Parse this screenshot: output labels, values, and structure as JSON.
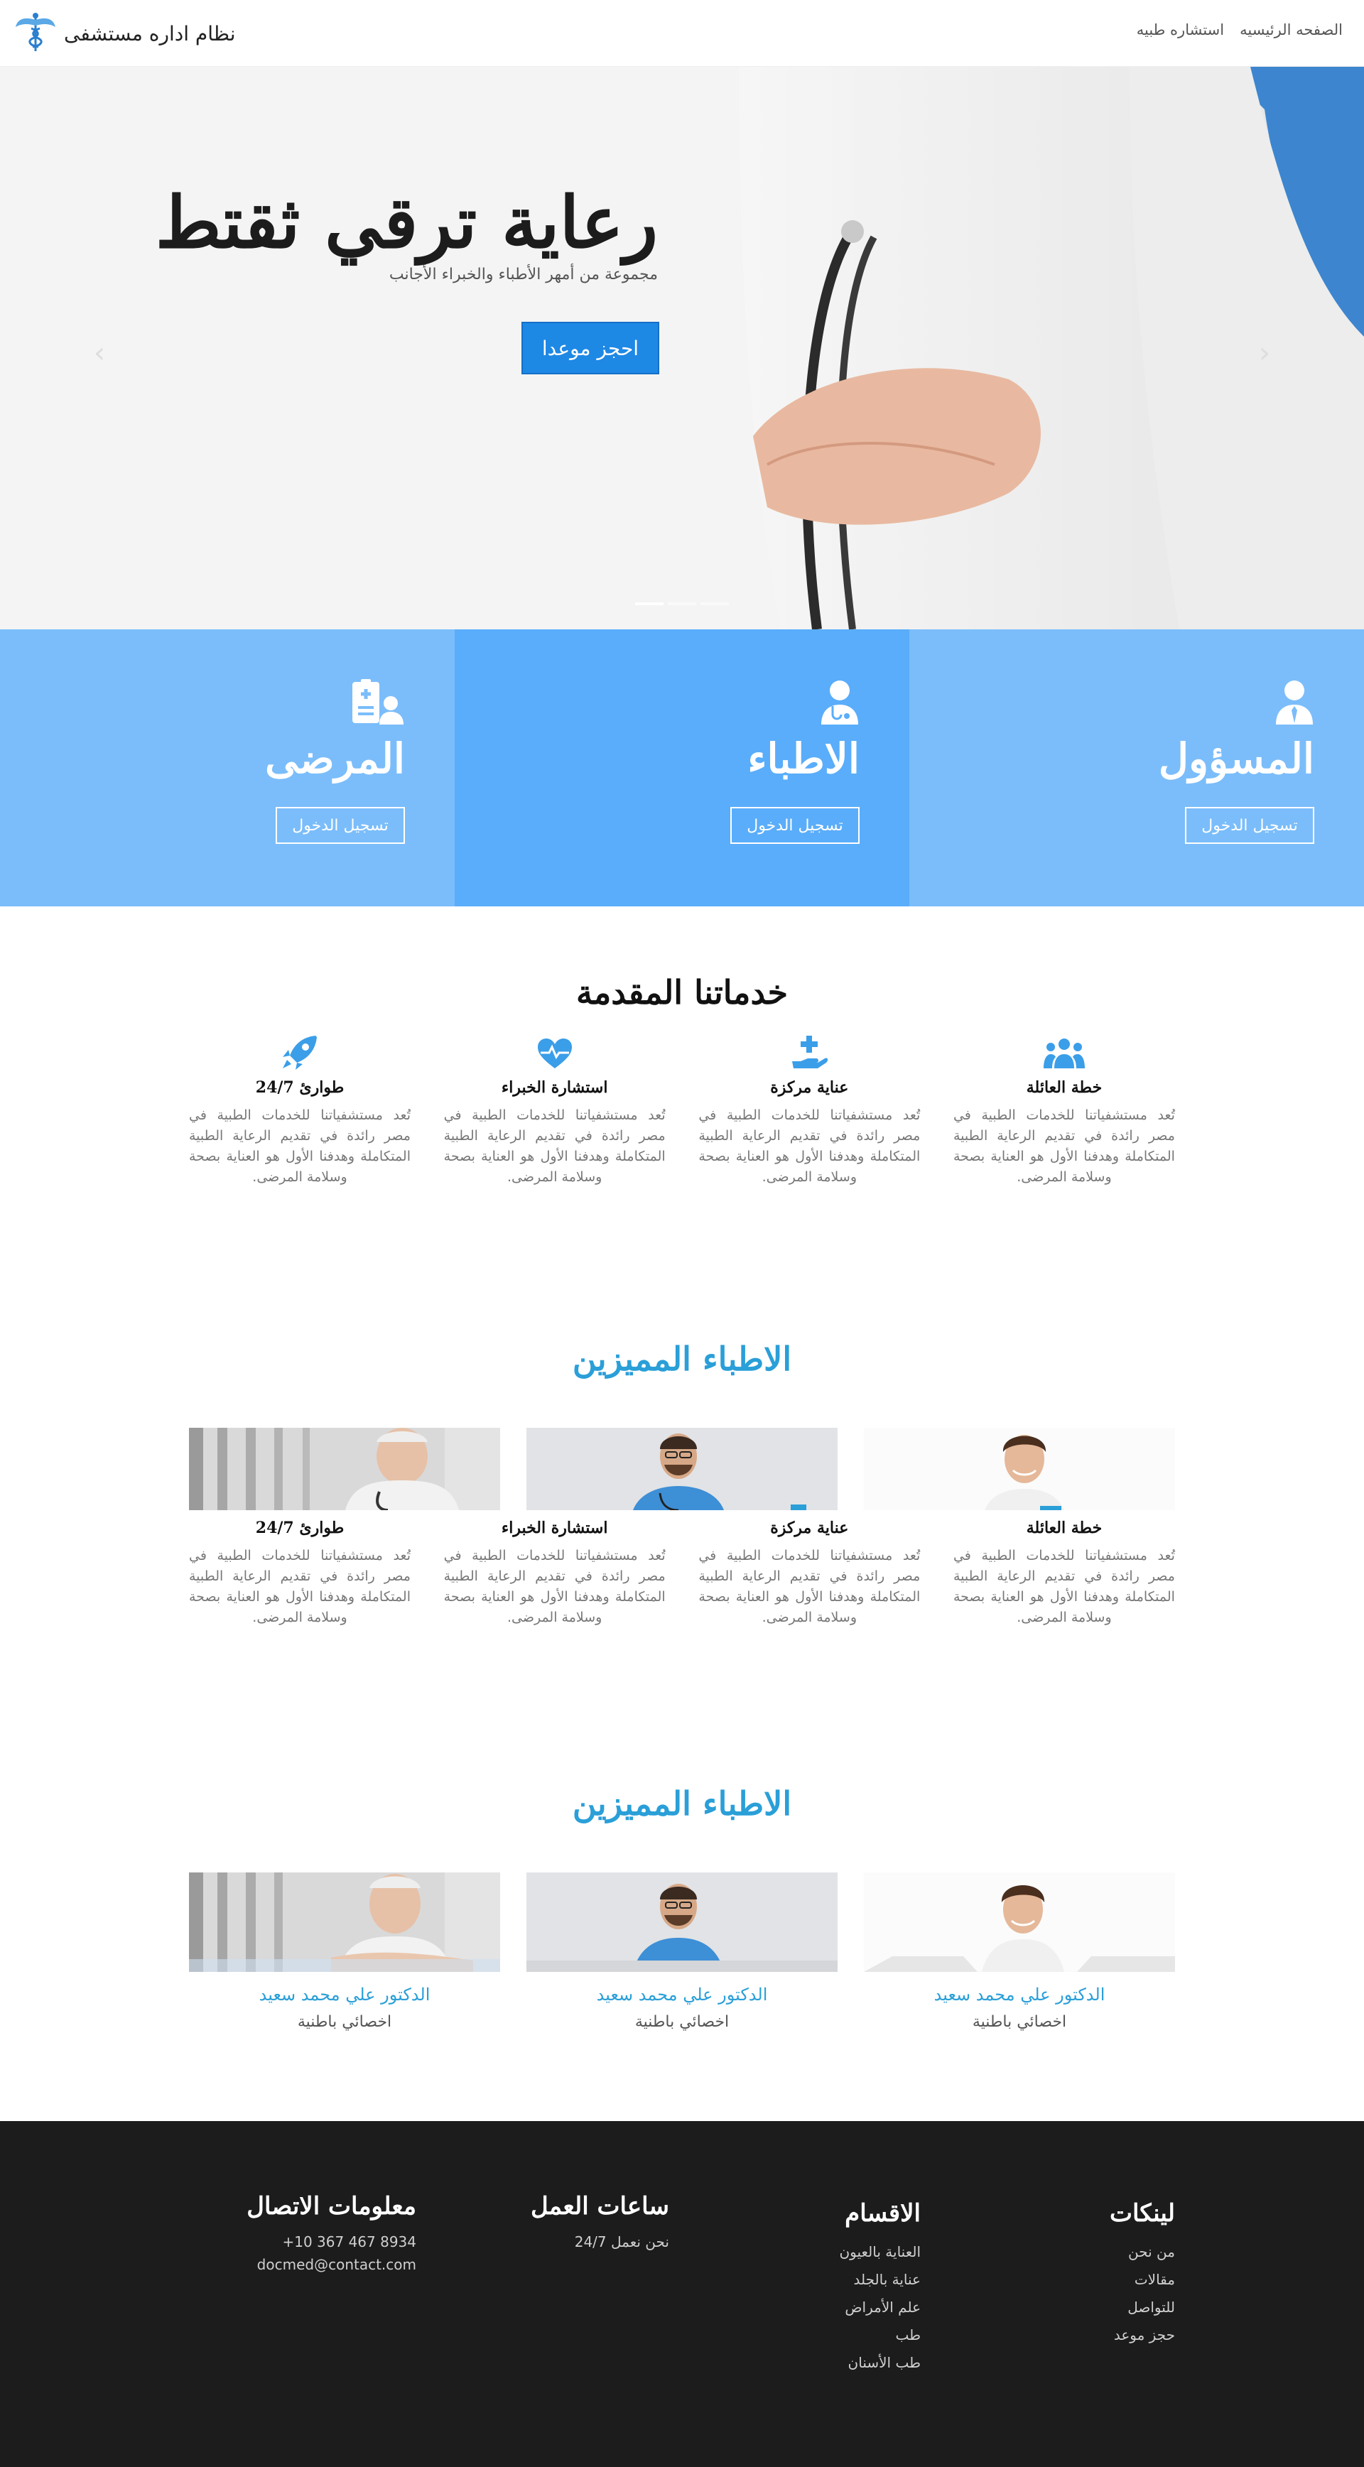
{
  "nav": {
    "brand": "نظام اداره مستشفى",
    "links": [
      "استشاره طبيه",
      "الصفحه الرئيسيه"
    ]
  },
  "hero": {
    "title": "رعاية ترقي ثقتط",
    "subtitle": "مجموعة من أمهر الأطباء والخبراء الأجانب",
    "cta": "احجز موعدا",
    "prev": "‹",
    "next": "›"
  },
  "login_panels": [
    {
      "title": "المرضى",
      "button": "تسجيل الدخول",
      "color": "#7bbdfa",
      "icon": "patient-icon"
    },
    {
      "title": "الاطباء",
      "button": "تسجيل الدخول",
      "color": "#5aadfa",
      "icon": "doctor-icon"
    },
    {
      "title": "المسؤول",
      "button": "تسجيل الدخول",
      "color": "#7bbdfa",
      "icon": "admin-icon"
    }
  ],
  "services": {
    "title": "خدماتنا المقدمة",
    "items": [
      {
        "title": "طوارئ 24/7",
        "icon": "rocket-icon",
        "text": "تُعد مستشفياتنا للخدمات الطبية في مصر رائدة في تقديم الرعاية الطبية المتكاملة وهدفنا الأول هو العناية بصحة وسلامة المرضى."
      },
      {
        "title": "استشارة الخبراء",
        "icon": "heartbeat-icon",
        "text": "تُعد مستشفياتنا للخدمات الطبية في مصر رائدة في تقديم الرعاية الطبية المتكاملة وهدفنا الأول هو العناية بصحة وسلامة المرضى."
      },
      {
        "title": "عناية مركزة",
        "icon": "hand-care-icon",
        "text": "تُعد مستشفياتنا للخدمات الطبية في مصر رائدة في تقديم الرعاية الطبية المتكاملة وهدفنا الأول هو العناية بصحة وسلامة المرضى."
      },
      {
        "title": "خطة العائلة",
        "icon": "family-icon",
        "text": "تُعد مستشفياتنا للخدمات الطبية في مصر رائدة في تقديم الرعاية الطبية المتكاملة وهدفنا الأول هو العناية بصحة وسلامة المرضى."
      }
    ]
  },
  "featured1": {
    "title": "الاطباء المميزين",
    "items": [
      {
        "title": "طوارئ 24/7",
        "text": "تُعد مستشفياتنا للخدمات الطبية في مصر رائدة في تقديم الرعاية الطبية المتكاملة وهدفنا الأول هو العناية بصحة وسلامة المرضى."
      },
      {
        "title": "استشارة الخبراء",
        "text": "تُعد مستشفياتنا للخدمات الطبية في مصر رائدة في تقديم الرعاية الطبية المتكاملة وهدفنا الأول هو العناية بصحة وسلامة المرضى."
      },
      {
        "title": "عناية مركزة",
        "text": "تُعد مستشفياتنا للخدمات الطبية في مصر رائدة في تقديم الرعاية الطبية المتكاملة وهدفنا الأول هو العناية بصحة وسلامة المرضى."
      },
      {
        "title": "خطة العائلة",
        "text": "تُعد مستشفياتنا للخدمات الطبية في مصر رائدة في تقديم الرعاية الطبية المتكاملة وهدفنا الأول هو العناية بصحة وسلامة المرضى."
      }
    ]
  },
  "featured2": {
    "title": "الاطباء المميزين",
    "doctors": [
      {
        "name": "الدكتور علي محمد سعيد",
        "role": "اخصائي باطنية"
      },
      {
        "name": "الدكتور علي محمد سعيد",
        "role": "اخصائي باطنية"
      },
      {
        "name": "الدكتور علي محمد سعيد",
        "role": "اخصائي باطنية"
      }
    ]
  },
  "footer": {
    "contact": {
      "title": "معلومات الاتصال",
      "phone": "+10 367 467 8934",
      "email": "docmed@contact.com"
    },
    "hours": {
      "title": "ساعات العمل",
      "text": "نحن نعمل 24/7"
    },
    "departments": {
      "title": "الاقسام",
      "items": [
        "العناية بالعيون",
        "عناية بالجلد",
        "علم الأمراض",
        "طب",
        "طب الأسنان"
      ]
    },
    "links": {
      "title": "لينكات",
      "items": [
        "من نحن",
        "مقالات",
        "للتواصل",
        "حجز موعد"
      ]
    }
  },
  "colors": {
    "accent": "#1e88e5",
    "heading_blue": "#2a9fd8",
    "icon_blue": "#3b9ee8",
    "footer_bg": "#1c1c1c"
  }
}
